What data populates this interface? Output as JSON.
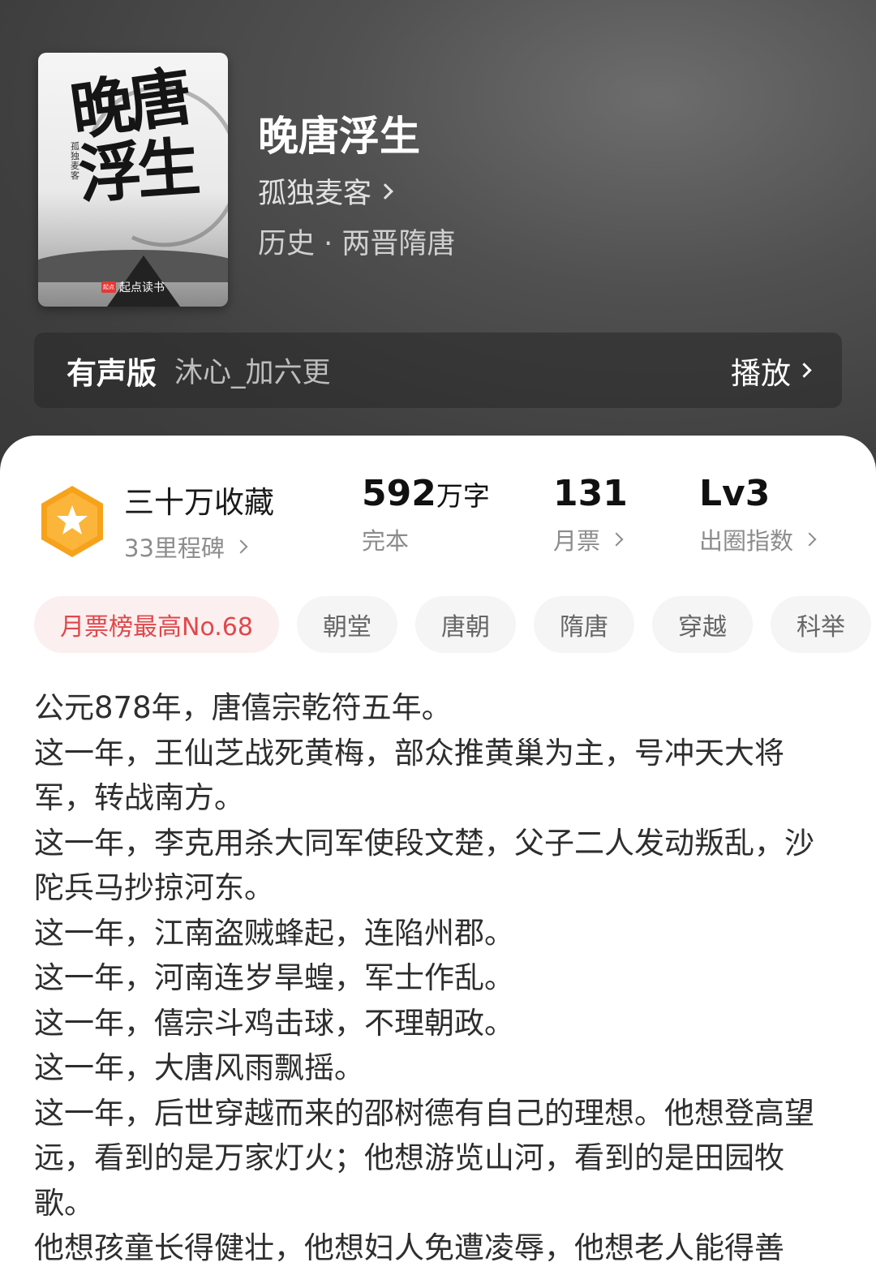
{
  "book": {
    "title": "晚唐浮生",
    "author": "孤独麦客",
    "genre": "历史 · 两晋隋唐",
    "cover": {
      "calligraphy_line1": "晚唐",
      "calligraphy_line2": "浮生",
      "author_vertical": "孤独麦客",
      "publisher": "起点读书",
      "publisher_logo": "起点"
    }
  },
  "audio": {
    "label": "有声版",
    "narrator": "沐心_加六更",
    "play_label": "播放"
  },
  "stats": {
    "collection": {
      "main": "三十万收藏",
      "sub": "33里程碑"
    },
    "words": {
      "value": "592",
      "unit": "万字",
      "sub": "完本"
    },
    "votes": {
      "value": "131",
      "sub": "月票"
    },
    "level": {
      "value": "Lv3",
      "sub": "出圈指数"
    }
  },
  "tags": [
    "月票榜最高No.68",
    "朝堂",
    "唐朝",
    "隋唐",
    "穿越",
    "科举"
  ],
  "synopsis": [
    "公元878年，唐僖宗乾符五年。",
    "这一年，王仙芝战死黄梅，部众推黄巢为主，号冲天大将军，转战南方。",
    "这一年，李克用杀大同军使段文楚，父子二人发动叛乱，沙陀兵马抄掠河东。",
    "这一年，江南盗贼蜂起，连陷州郡。",
    "这一年，河南连岁旱蝗，军士作乱。",
    "这一年，僖宗斗鸡击球，不理朝政。",
    "这一年，大唐风雨飘摇。",
    "这一年，后世穿越而来的邵树德有自己的理想。他想登高望远，看到的是万家灯火；他想游览山河，看到的是田园牧歌。",
    "他想孩童长得健壮，他想妇人免遭凌辱，他想老人能得善"
  ],
  "colors": {
    "accent_red": "#e0484b",
    "badge_orange": "#f7a21b"
  }
}
